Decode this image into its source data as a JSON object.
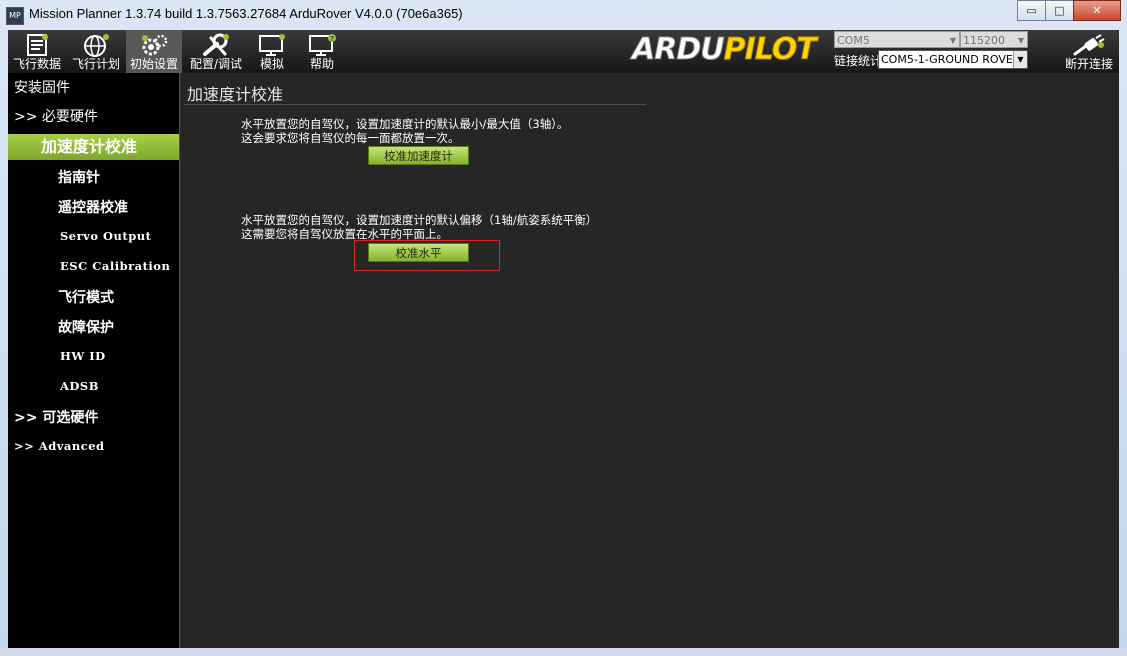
{
  "window": {
    "title": "Mission Planner 1.3.74 build 1.3.7563.27684 ArduRover V4.0.0 (70e6a365)",
    "app_icon_text": "MP",
    "minimize": "▭",
    "maximize": "□",
    "close": "✕"
  },
  "toolbar": {
    "items": [
      {
        "label": "飞行数据",
        "icon": "flight-data-icon"
      },
      {
        "label": "飞行计划",
        "icon": "flight-plan-icon"
      },
      {
        "label": "初始设置",
        "icon": "initial-setup-icon"
      },
      {
        "label": "配置/调试",
        "icon": "config-tuning-icon"
      },
      {
        "label": "模拟",
        "icon": "simulation-icon"
      },
      {
        "label": "帮助",
        "icon": "help-icon"
      }
    ],
    "active_index": 2,
    "logo_part1": "ARDU",
    "logo_part2": "PILOT",
    "port": "COM5",
    "baud": "115200",
    "link_label": "链接统计",
    "link_value": "COM5-1-GROUND ROVER",
    "disconnect_label": "断开连接"
  },
  "sidebar": {
    "items": [
      {
        "label": "安装固件",
        "type": "top"
      },
      {
        "label": ">> 必要硬件",
        "type": "top"
      },
      {
        "label": "加速度计校准",
        "type": "active"
      },
      {
        "label": "指南针",
        "type": "sub"
      },
      {
        "label": "遥控器校准",
        "type": "sub"
      },
      {
        "label": "Servo Output",
        "type": "mono"
      },
      {
        "label": "ESC Calibration",
        "type": "mono"
      },
      {
        "label": "飞行模式",
        "type": "sub"
      },
      {
        "label": "故障保护",
        "type": "sub"
      },
      {
        "label": "HW ID",
        "type": "mono"
      },
      {
        "label": "ADSB",
        "type": "mono"
      },
      {
        "label": ">> 可选硬件",
        "type": "top"
      },
      {
        "label": ">> Advanced",
        "type": "mono-top"
      }
    ]
  },
  "content": {
    "title": "加速度计校准",
    "section1": {
      "line1": "水平放置您的自驾仪，设置加速度计的默认最小/最大值（3轴）。",
      "line2": "这会要求您将自驾仪的每一面都放置一次。",
      "button": "校准加速度计"
    },
    "section2": {
      "line1": "水平放置您的自驾仪，设置加速度计的默认偏移（1轴/航姿系统平衡）",
      "line2": "这需要您将自驾仪放置在水平的平面上。",
      "button": "校准水平"
    }
  },
  "colors": {
    "toolbar_bg": "#1e1e1e",
    "sidebar_bg": "#000000",
    "content_bg": "#262626",
    "accent_green": "#9ac13d",
    "logo_yellow": "#ffd400",
    "highlight_red": "#dd2222"
  }
}
